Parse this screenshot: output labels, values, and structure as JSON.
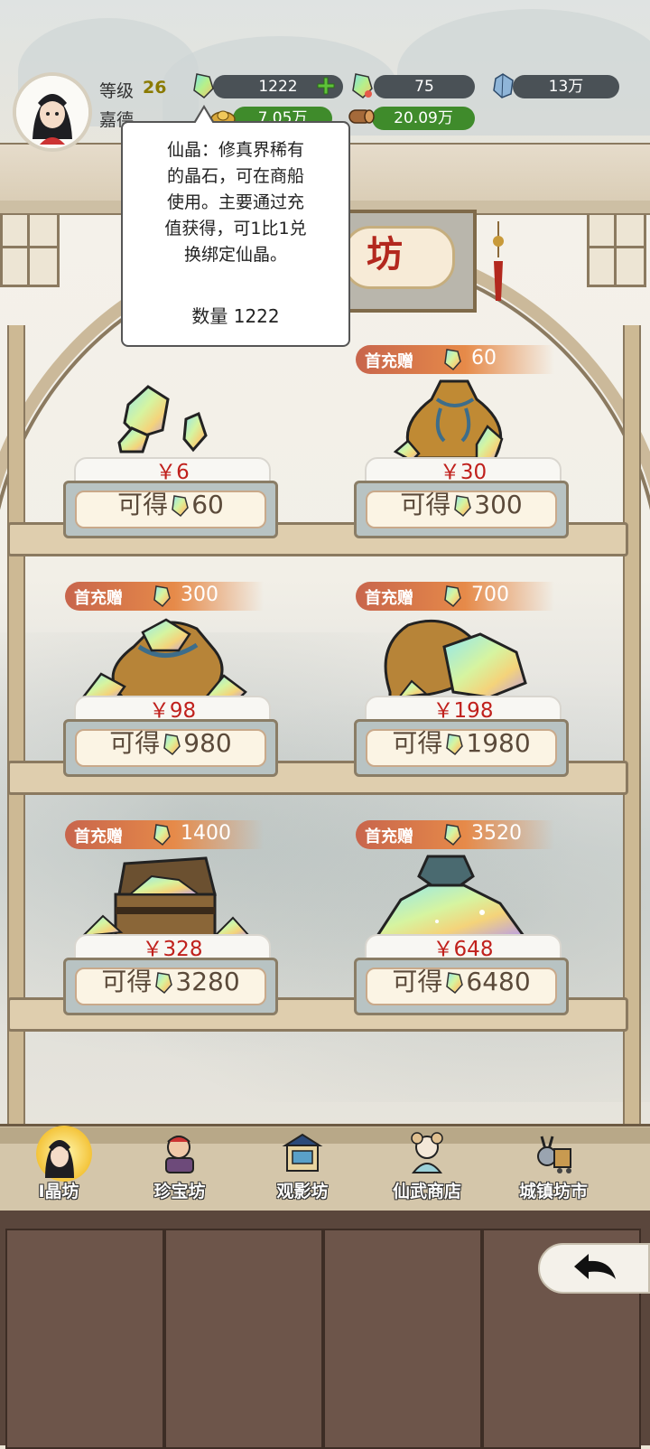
{
  "header": {
    "level_label": "等级",
    "level_value": "26",
    "player_name": "嘉德",
    "currencies": [
      {
        "name": "xian_jing",
        "value": "1222",
        "icon": "rainbow-crystal-icon",
        "has_add": true
      },
      {
        "name": "bound_xian_jing",
        "value": "75",
        "icon": "rainbow-crystal-bound-icon",
        "has_add": false
      },
      {
        "name": "spirit_stone",
        "value": "13万",
        "icon": "blue-crystal-icon",
        "has_add": false
      },
      {
        "name": "gold",
        "value": "7.05万",
        "icon": "gold-ingot-icon",
        "has_add": false
      },
      {
        "name": "wood",
        "value": "20.09万",
        "icon": "wood-log-icon",
        "has_add": false
      }
    ]
  },
  "tooltip": {
    "lines": [
      "仙晶：修真界稀有",
      "的晶石，可在商船",
      "使用。主要通过充",
      "值获得，可1比1兑",
      "换绑定仙晶。"
    ],
    "quantity": "数量 1222"
  },
  "sign": {
    "visible_char": "坊"
  },
  "products": [
    {
      "price": "￥6",
      "gain_prefix": "可得",
      "gain_value": "60",
      "bonus": null
    },
    {
      "price": "￥30",
      "gain_prefix": "可得",
      "gain_value": "300",
      "bonus": {
        "label": "首充赠",
        "value": "60"
      }
    },
    {
      "price": "￥98",
      "gain_prefix": "可得",
      "gain_value": "980",
      "bonus": {
        "label": "首充赠",
        "value": "300"
      }
    },
    {
      "price": "￥198",
      "gain_prefix": "可得",
      "gain_value": "1980",
      "bonus": {
        "label": "首充赠",
        "value": "700"
      }
    },
    {
      "price": "￥328",
      "gain_prefix": "可得",
      "gain_value": "3280",
      "bonus": {
        "label": "首充赠",
        "value": "1400"
      }
    },
    {
      "price": "￥648",
      "gain_prefix": "可得",
      "gain_value": "6480",
      "bonus": {
        "label": "首充赠",
        "value": "3520"
      }
    }
  ],
  "nav": {
    "items": [
      {
        "label": "I晶坊",
        "icon": "crystal-shop-icon",
        "active": true
      },
      {
        "label": "珍宝坊",
        "icon": "treasure-shop-icon",
        "active": false
      },
      {
        "label": "观影坊",
        "icon": "theater-shop-icon",
        "active": false
      },
      {
        "label": "仙武商店",
        "icon": "martial-shop-icon",
        "active": false
      },
      {
        "label": "城镇坊市",
        "icon": "town-market-icon",
        "active": false
      }
    ]
  },
  "colors": {
    "price_red": "#c0201c",
    "bonus_orange": "#e68a49",
    "pill_dark": "#4a5156",
    "pill_green": "#3f8b2b",
    "frame_brown": "#8b7a60"
  },
  "back_button": {
    "icon": "back-arrow-icon"
  }
}
